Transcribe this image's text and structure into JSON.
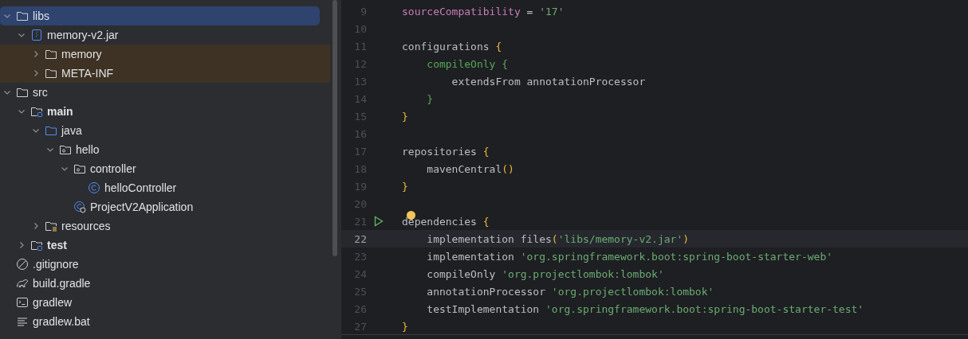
{
  "project_tree": [
    {
      "name": "libs",
      "kind": "folder",
      "expanded": true,
      "selected": true,
      "highlighted": false,
      "bold": false,
      "children": [
        {
          "name": "memory-v2.jar",
          "kind": "jar",
          "expanded": true,
          "selected": false,
          "highlighted": false,
          "bold": false,
          "children": [
            {
              "name": "memory",
              "kind": "folder",
              "expanded": false,
              "selected": false,
              "highlighted": true,
              "bold": false
            },
            {
              "name": "META-INF",
              "kind": "folder",
              "expanded": false,
              "selected": false,
              "highlighted": true,
              "bold": false
            }
          ]
        }
      ]
    },
    {
      "name": "src",
      "kind": "folder",
      "expanded": true,
      "selected": false,
      "highlighted": false,
      "bold": false,
      "children": [
        {
          "name": "main",
          "kind": "module",
          "expanded": true,
          "selected": false,
          "highlighted": false,
          "bold": true,
          "children": [
            {
              "name": "java",
              "kind": "source",
              "expanded": true,
              "selected": false,
              "highlighted": false,
              "bold": false,
              "children": [
                {
                  "name": "hello",
                  "kind": "package",
                  "expanded": true,
                  "selected": false,
                  "highlighted": false,
                  "bold": false,
                  "children": [
                    {
                      "name": "controller",
                      "kind": "package",
                      "expanded": true,
                      "selected": false,
                      "highlighted": false,
                      "bold": false,
                      "children": [
                        {
                          "name": "helloController",
                          "kind": "class",
                          "selected": false,
                          "highlighted": false,
                          "bold": false
                        }
                      ]
                    },
                    {
                      "name": "ProjectV2Application",
                      "kind": "app",
                      "selected": false,
                      "highlighted": false,
                      "bold": false
                    }
                  ]
                }
              ]
            },
            {
              "name": "resources",
              "kind": "resources",
              "expanded": false,
              "selected": false,
              "highlighted": false,
              "bold": false
            }
          ]
        },
        {
          "name": "test",
          "kind": "module",
          "expanded": false,
          "selected": false,
          "highlighted": false,
          "bold": true
        }
      ]
    },
    {
      "name": ".gitignore",
      "kind": "ignore",
      "selected": false,
      "highlighted": false,
      "bold": false
    },
    {
      "name": "build.gradle",
      "kind": "gradle",
      "selected": false,
      "highlighted": false,
      "bold": false
    },
    {
      "name": "gradlew",
      "kind": "shell",
      "selected": false,
      "highlighted": false,
      "bold": false
    },
    {
      "name": "gradlew.bat",
      "kind": "text",
      "selected": false,
      "highlighted": false,
      "bold": false
    }
  ],
  "editor": {
    "lines": [
      {
        "number": "9",
        "current": false,
        "tokens": [
          {
            "kind": "prop",
            "text": "sourceCompatibility"
          },
          {
            "kind": "plain",
            "text": " = "
          },
          {
            "kind": "string",
            "text": "'17'"
          }
        ]
      },
      {
        "number": "10",
        "current": false
      },
      {
        "number": "11",
        "current": false,
        "tokens": [
          {
            "kind": "plain",
            "text": "configurations "
          },
          {
            "kind": "brace",
            "text": "{"
          }
        ]
      },
      {
        "number": "12",
        "current": false,
        "tokens": [
          {
            "kind": "block",
            "text": "    compileOnly {"
          }
        ]
      },
      {
        "number": "13",
        "current": false,
        "tokens": [
          {
            "kind": "plain",
            "text": "        extendsFrom annotationProcessor"
          }
        ]
      },
      {
        "number": "14",
        "current": false,
        "tokens": [
          {
            "kind": "block",
            "text": "    }"
          }
        ]
      },
      {
        "number": "15",
        "current": false,
        "tokens": [
          {
            "kind": "brace",
            "text": "}"
          }
        ]
      },
      {
        "number": "16",
        "current": false
      },
      {
        "number": "17",
        "current": false,
        "tokens": [
          {
            "kind": "plain",
            "text": "repositories "
          },
          {
            "kind": "brace",
            "text": "{"
          }
        ]
      },
      {
        "number": "18",
        "current": false,
        "tokens": [
          {
            "kind": "plain",
            "text": "    mavenCentral"
          },
          {
            "kind": "brace",
            "text": "()"
          }
        ]
      },
      {
        "number": "19",
        "current": false,
        "tokens": [
          {
            "kind": "brace",
            "text": "}"
          }
        ]
      },
      {
        "number": "20",
        "current": false
      },
      {
        "number": "21",
        "current": false,
        "runnable": true,
        "intention": true,
        "tokens": [
          {
            "kind": "plain",
            "text": "dependencies "
          },
          {
            "kind": "brace",
            "text": "{"
          }
        ]
      },
      {
        "number": "22",
        "current": true,
        "tokens": [
          {
            "kind": "plain",
            "text": "    implementation files"
          },
          {
            "kind": "brace",
            "text": "("
          },
          {
            "kind": "string",
            "text": "'libs/memory-v2.jar'"
          },
          {
            "kind": "brace",
            "text": ")"
          }
        ]
      },
      {
        "number": "23",
        "current": false,
        "tokens": [
          {
            "kind": "plain",
            "text": "    implementation "
          },
          {
            "kind": "string",
            "text": "'org.springframework.boot:spring-boot-starter-web'"
          }
        ]
      },
      {
        "number": "24",
        "current": false,
        "tokens": [
          {
            "kind": "plain",
            "text": "    compileOnly "
          },
          {
            "kind": "string",
            "text": "'org.projectlombok:lombok'"
          }
        ]
      },
      {
        "number": "25",
        "current": false,
        "tokens": [
          {
            "kind": "plain",
            "text": "    annotationProcessor "
          },
          {
            "kind": "string",
            "text": "'org.projectlombok:lombok'"
          }
        ]
      },
      {
        "number": "26",
        "current": false,
        "tokens": [
          {
            "kind": "plain",
            "text": "    testImplementation "
          },
          {
            "kind": "string",
            "text": "'org.springframework.boot:spring-boot-starter-test'"
          }
        ]
      },
      {
        "number": "27",
        "current": false,
        "tokens": [
          {
            "kind": "brace",
            "text": "}"
          }
        ]
      }
    ]
  }
}
